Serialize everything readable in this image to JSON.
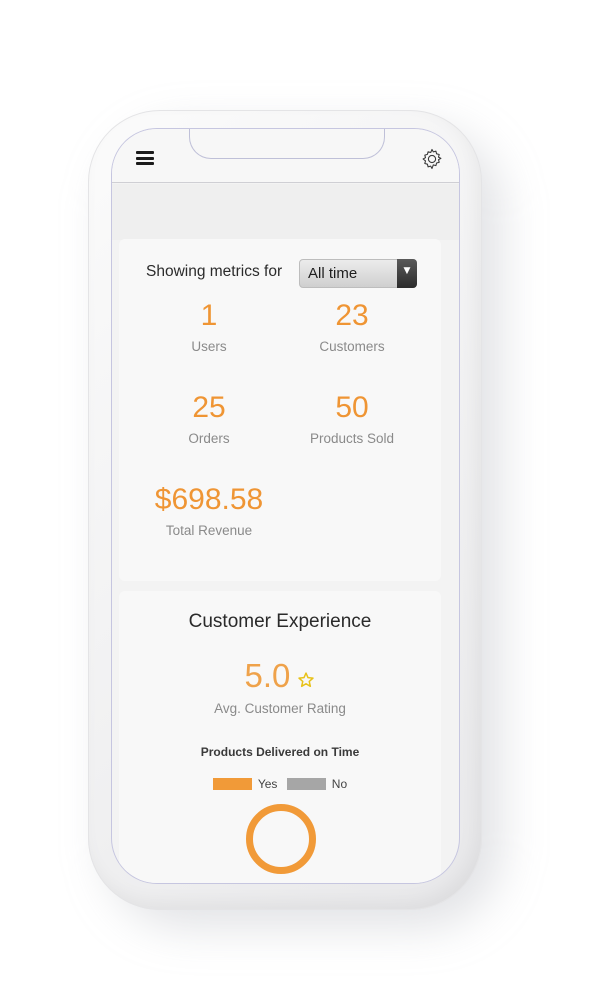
{
  "header": {
    "menu_icon": "hamburger-menu-icon",
    "settings_icon": "gear-icon"
  },
  "metrics": {
    "filter_label": "Showing metrics for",
    "filter_value": "All time",
    "items": [
      {
        "value": "1",
        "label": "Users"
      },
      {
        "value": "23",
        "label": "Customers"
      },
      {
        "value": "25",
        "label": "Orders"
      },
      {
        "value": "50",
        "label": "Products Sold"
      },
      {
        "value": "$698.58",
        "label": "Total Revenue"
      }
    ]
  },
  "customer_experience": {
    "title": "Customer Experience",
    "rating_value": "5.0",
    "rating_icon": "star-icon",
    "rating_label": "Avg. Customer Rating"
  },
  "chart_data": {
    "type": "pie",
    "title": "Products Delivered on Time",
    "categories": [
      "Yes",
      "No"
    ],
    "values": [
      100,
      0
    ],
    "colors": [
      "#f19a38",
      "#a6a6a6"
    ],
    "legend_position": "top"
  },
  "colors": {
    "accent": "#ef9534",
    "yes": "#f19a38",
    "no": "#a6a6a6"
  }
}
